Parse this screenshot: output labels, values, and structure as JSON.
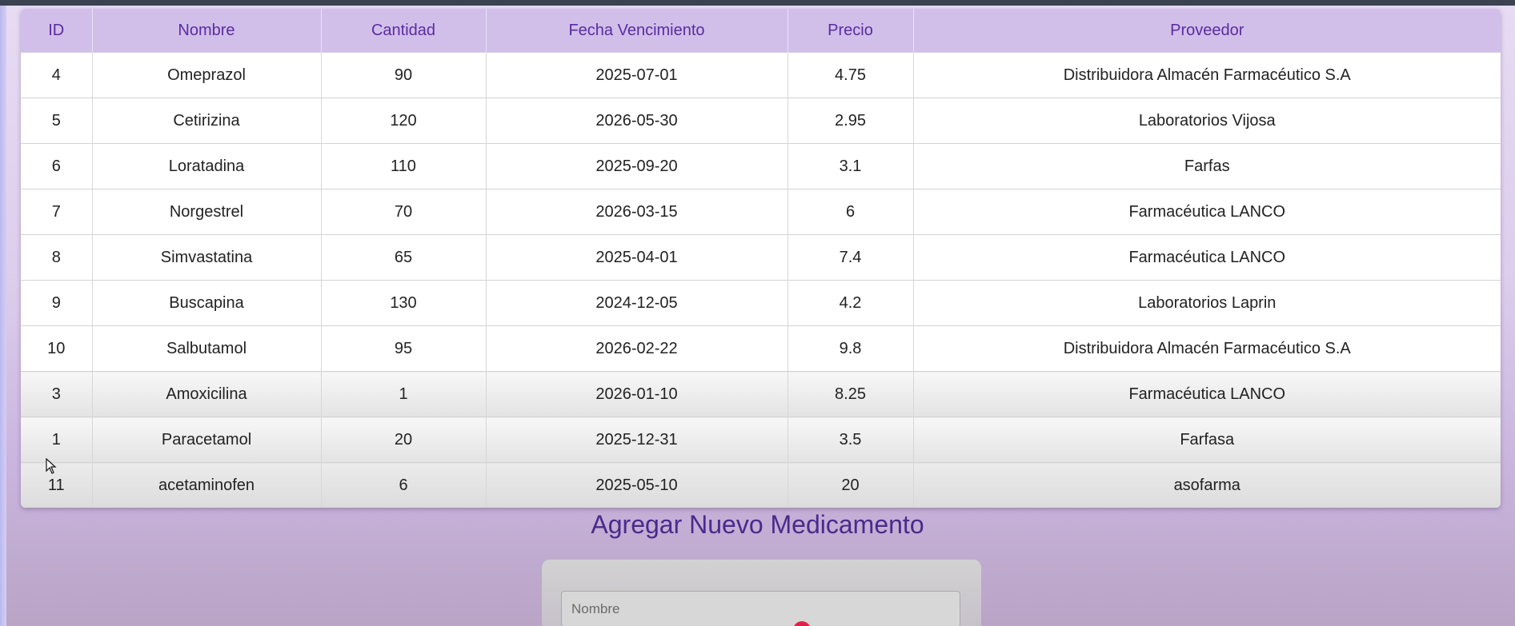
{
  "table": {
    "headers": [
      "ID",
      "Nombre",
      "Cantidad",
      "Fecha Vencimiento",
      "Precio",
      "Proveedor"
    ],
    "rows": [
      [
        "4",
        "Omeprazol",
        "90",
        "2025-07-01",
        "4.75",
        "Distribuidora Almacén Farmacéutico S.A"
      ],
      [
        "5",
        "Cetirizina",
        "120",
        "2026-05-30",
        "2.95",
        "Laboratorios Vijosa"
      ],
      [
        "6",
        "Loratadina",
        "110",
        "2025-09-20",
        "3.1",
        "Farfas"
      ],
      [
        "7",
        "Norgestrel",
        "70",
        "2026-03-15",
        "6",
        "Farmacéutica LANCO"
      ],
      [
        "8",
        "Simvastatina",
        "65",
        "2025-04-01",
        "7.4",
        "Farmacéutica LANCO"
      ],
      [
        "9",
        "Buscapina",
        "130",
        "2024-12-05",
        "4.2",
        "Laboratorios Laprin"
      ],
      [
        "10",
        "Salbutamol",
        "95",
        "2026-02-22",
        "9.8",
        "Distribuidora Almacén Farmacéutico S.A"
      ],
      [
        "3",
        "Amoxicilina",
        "1",
        "2026-01-10",
        "8.25",
        "Farmacéutica LANCO"
      ],
      [
        "1",
        "Paracetamol",
        "20",
        "2025-12-31",
        "3.5",
        "Farfasa"
      ],
      [
        "11",
        "acetaminofen",
        "6",
        "2025-05-10",
        "20",
        "asofarma"
      ]
    ]
  },
  "form": {
    "title": "Agregar Nuevo Medicamento",
    "name_placeholder": "Nombre"
  },
  "colors": {
    "header_bg": "#d1bfea",
    "header_text": "#5a2ca0",
    "title_text": "#4a2a8c",
    "accent_dot": "#e0204a"
  }
}
